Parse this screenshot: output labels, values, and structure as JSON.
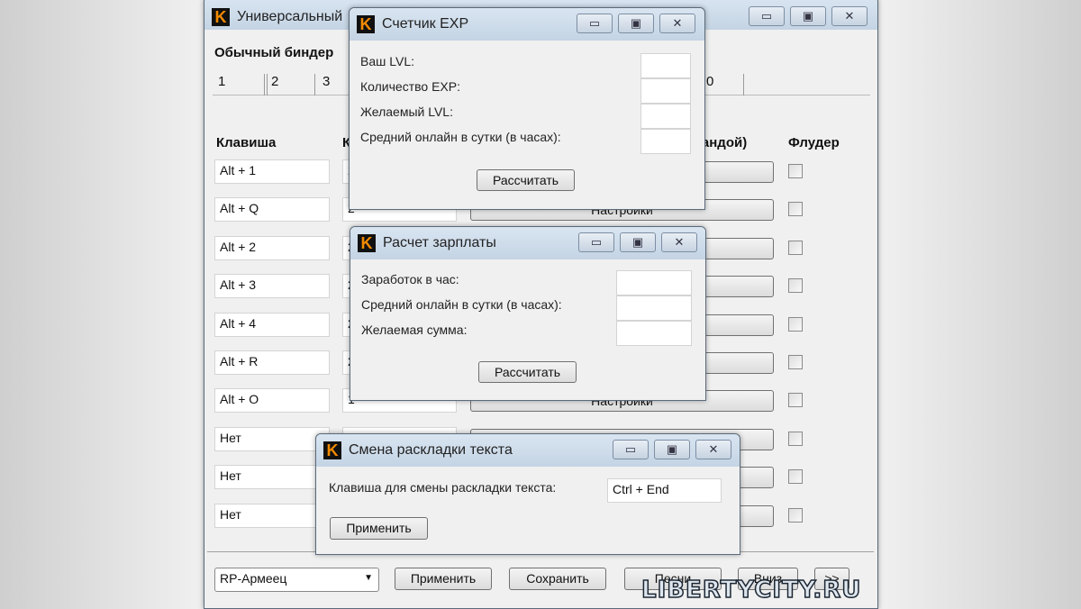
{
  "main": {
    "title": "Универсальный",
    "section": "Обычный биндер",
    "tabs": [
      "1",
      "2",
      "3",
      "0"
    ],
    "headers": {
      "key": "Клавиша",
      "second": "К",
      "command": "мандой)",
      "flooder": "Флудер"
    },
    "rows": [
      {
        "key": "Alt + 1",
        "val": "2",
        "button": ""
      },
      {
        "key": "Alt + Q",
        "val": "2",
        "button": "Настройки"
      },
      {
        "key": "Alt + 2",
        "val": "2",
        "button": ""
      },
      {
        "key": "Alt + 3",
        "val": "2",
        "button": ""
      },
      {
        "key": "Alt + 4",
        "val": "2",
        "button": ""
      },
      {
        "key": "Alt + R",
        "val": "2",
        "button": ""
      },
      {
        "key": "Alt + O",
        "val": "1",
        "button": "Настройки"
      },
      {
        "key": "Нет",
        "val": "",
        "button": ""
      },
      {
        "key": "Нет",
        "val": "",
        "button": ""
      },
      {
        "key": "Нет",
        "val": "",
        "button": ""
      }
    ],
    "profile": "RP-Армеец",
    "apply": "Применить",
    "save": "Сохранить",
    "songs": "Песни",
    "down": "Вниз",
    "next": ">>"
  },
  "exp": {
    "title": "Счетчик EXP",
    "labels": [
      "Ваш LVL:",
      "Количество EXP:",
      "Желаемый LVL:",
      "Средний онлайн в сутки (в часах):"
    ],
    "button": "Рассчитать"
  },
  "salary": {
    "title": "Расчет зарплаты",
    "labels": [
      "Заработок в час:",
      "Средний онлайн в сутки (в часах):",
      "Желаемая сумма:"
    ],
    "button": "Рассчитать"
  },
  "layout": {
    "title": "Смена раскладки текста",
    "label": "Клавиша для смены раскладки текста:",
    "value": "Ctrl + End",
    "button": "Применить"
  },
  "window_controls": {
    "minimize": "▭",
    "maximize": "▣",
    "close": "✕"
  },
  "watermark": "LIBERTYCITY.RU"
}
